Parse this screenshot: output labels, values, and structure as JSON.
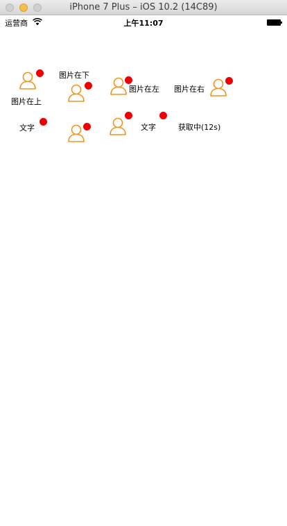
{
  "window": {
    "title": "iPhone 7 Plus – iOS 10.2 (14C89)"
  },
  "status_bar": {
    "carrier": "运营商",
    "time": "上午11:07"
  },
  "colors": {
    "icon": "#f0931f",
    "badge": "#ee0000"
  },
  "buttons": {
    "image_top": {
      "label": "图片在上",
      "icon": "person-icon"
    },
    "image_bottom": {
      "label": "图片在下",
      "icon": "person-icon"
    },
    "image_left": {
      "label": "图片在左",
      "icon": "person-icon"
    },
    "image_right": {
      "label": "图片在右",
      "icon": "person-icon"
    },
    "text_only": {
      "label": "文字"
    },
    "icon_only_1": {
      "icon": "person-icon"
    },
    "icon_only_2": {
      "icon": "person-icon"
    },
    "text_badge": {
      "label": "文字"
    },
    "countdown": {
      "label": "获取中(12s)"
    }
  }
}
